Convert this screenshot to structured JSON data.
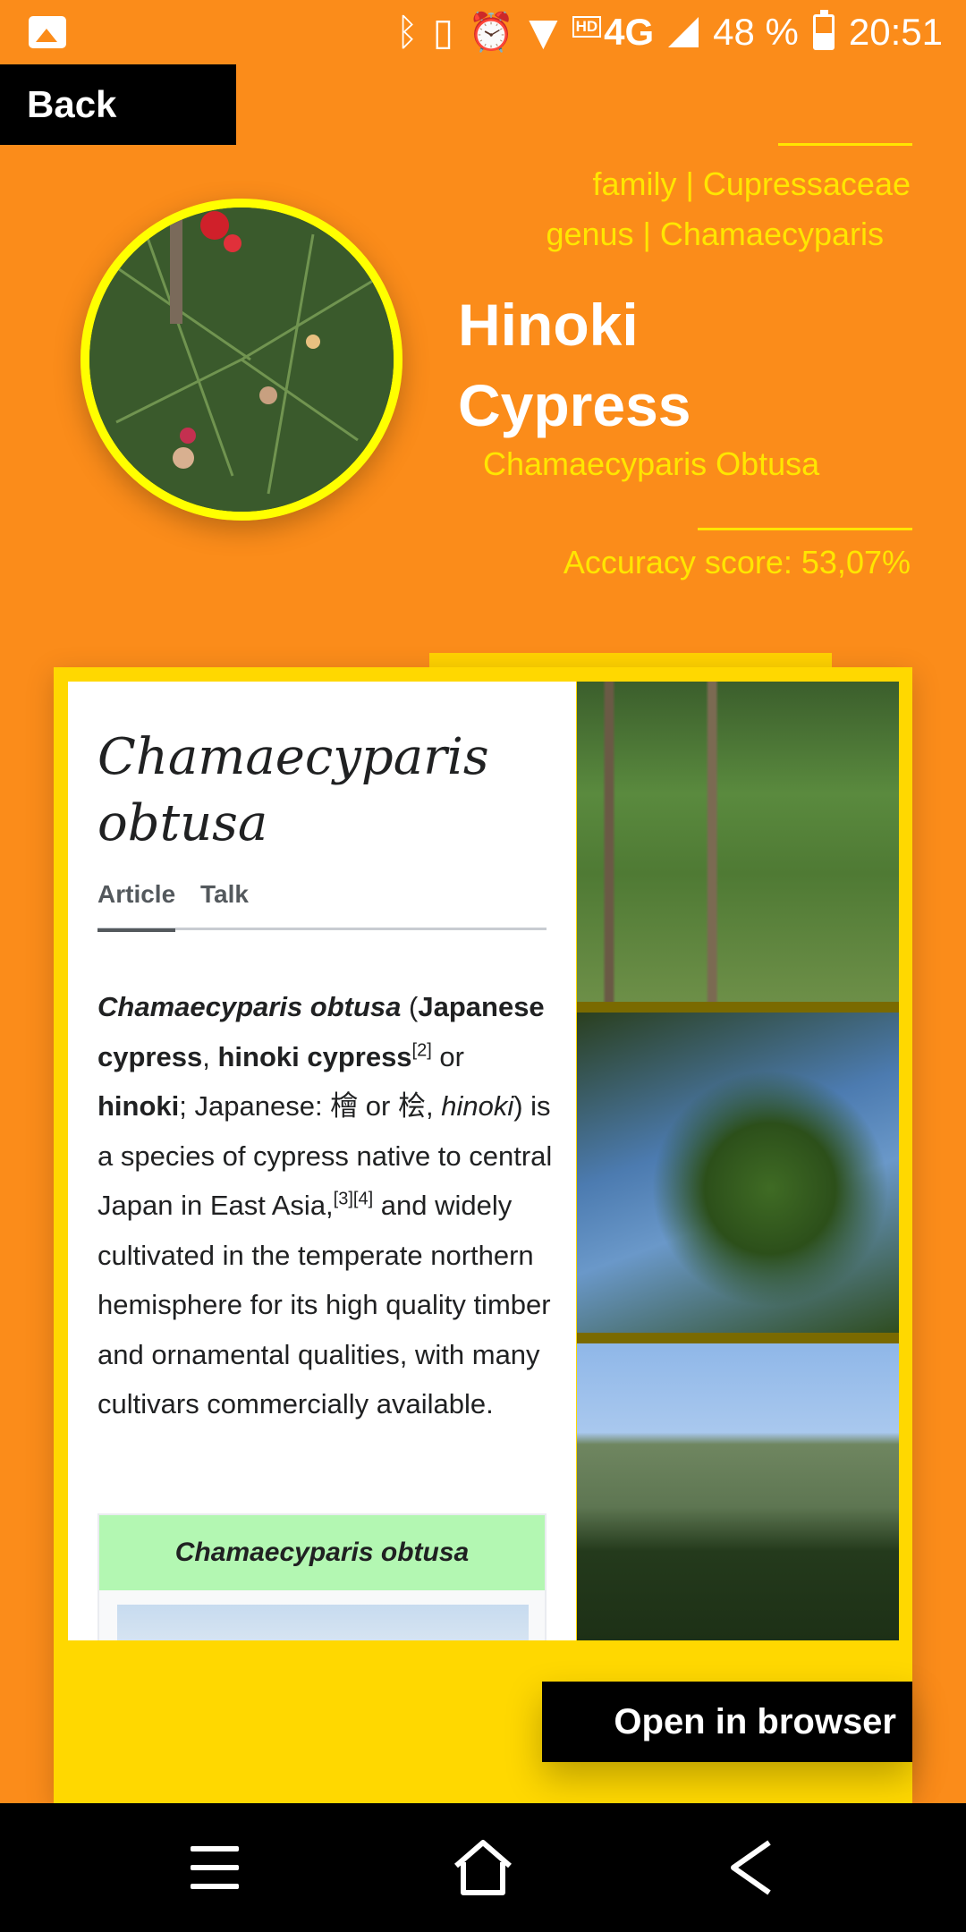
{
  "status_bar": {
    "icons": [
      "gallery-icon",
      "bluetooth-icon",
      "vibrate-icon",
      "alarm-icon",
      "wifi-icon",
      "signal-icon",
      "battery-icon"
    ],
    "network_hd": "HD",
    "network_type": "4G",
    "battery": "48 %",
    "battery_level": 0.48,
    "time": "20:51"
  },
  "header": {
    "back_label": "Back",
    "family": "family | Cupressaceae",
    "genus": "genus | Chamaecyparis",
    "title_line1": "Hinoki",
    "title_line2": "Cypress",
    "scientific_name": "Chamaecyparis Obtusa",
    "accuracy": "Accuracy score: 53,07%"
  },
  "wiki": {
    "heading_line1": "Chamaecyparis",
    "heading_line2": "obtusa",
    "tabs": [
      "Article",
      "Talk"
    ],
    "body": {
      "p1_b1": "Chamaecyparis obtusa",
      "p1_t1": " (",
      "p1_b2": "Japanese cypress",
      "p1_t2": ", ",
      "p1_b3": "hinoki cypress",
      "ref2": "[2]",
      "p1_t3": " or ",
      "p1_b4": "hinoki",
      "p1_t4": "; Japanese: 檜 or 桧, ",
      "p1_i1": "hinoki",
      "p1_t5": ") is a species of cypress native to central Japan in East Asia,",
      "ref3": "[3]",
      "ref4": "[4]",
      "p1_t6": " and widely cultivated in the temperate northern hemisphere for its high quality timber and ornamental qualities, with many cultivars commercially available."
    },
    "infobox_title": "Chamaecyparis obtusa"
  },
  "open_button_label": "Open in browser",
  "nav": {
    "items": [
      "menu-icon",
      "home-icon",
      "back-arrow-icon"
    ]
  },
  "colors": {
    "background": "#fb8c1a",
    "accent_yellow": "#ffe600",
    "card": "#ffd800",
    "infobox_header": "#b3f7b2"
  }
}
